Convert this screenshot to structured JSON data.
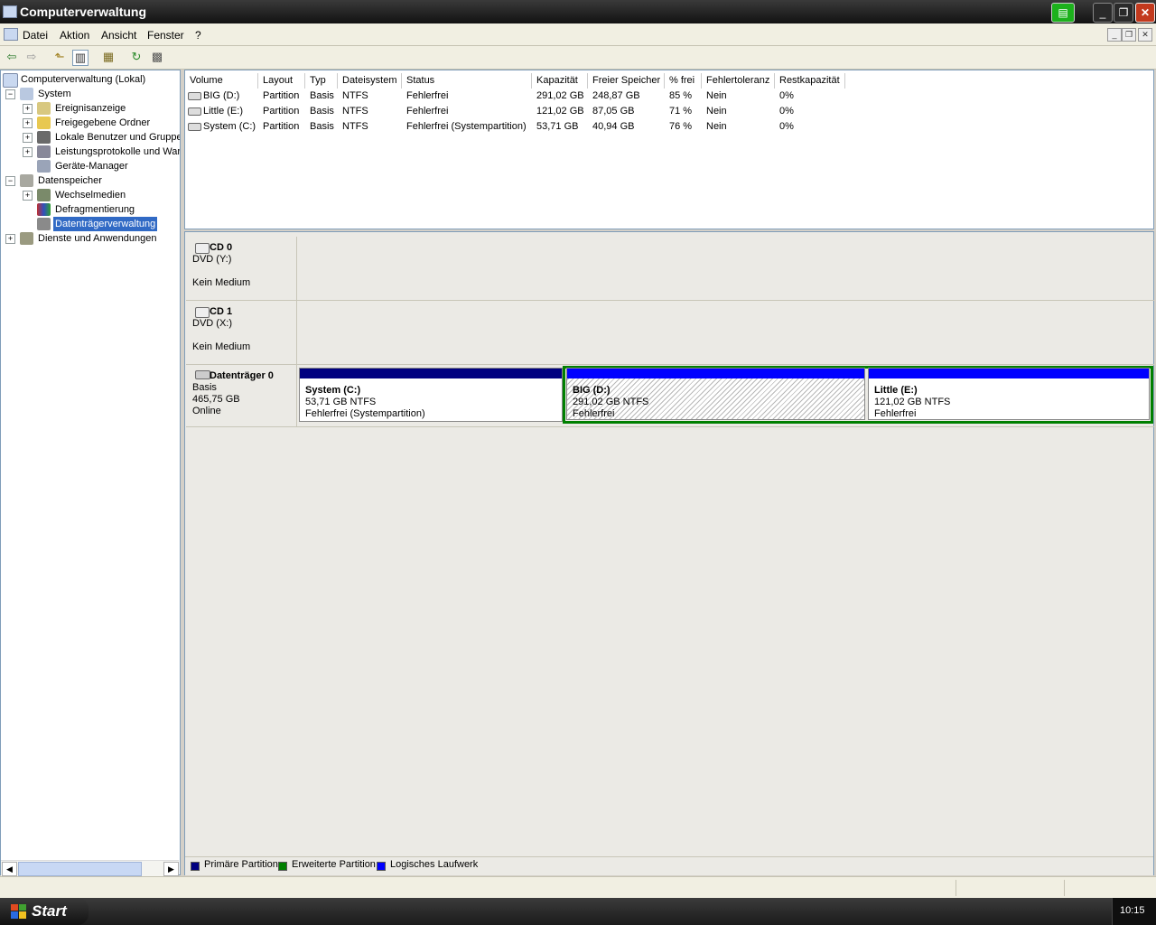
{
  "window": {
    "title": "Computerverwaltung"
  },
  "menu": [
    "Datei",
    "Aktion",
    "Ansicht",
    "Fenster",
    "?"
  ],
  "toolbar_icons": [
    "back-arrow-icon",
    "forward-arrow-icon",
    "up-folder-icon",
    "show-tree-icon",
    "properties-icon",
    "refresh-icon",
    "settings-icon"
  ],
  "tree": {
    "root": "Computerverwaltung (Lokal)",
    "system": "System",
    "ereignis": "Ereignisanzeige",
    "freigegeben": "Freigegebene Ordner",
    "benutzer": "Lokale Benutzer und Gruppen",
    "leistung": "Leistungsprotokolle und Warnungen",
    "geraete": "Geräte-Manager",
    "datenspeicher": "Datenspeicher",
    "wechsel": "Wechselmedien",
    "defrag": "Defragmentierung",
    "disk": "Datenträgerverwaltung",
    "dienste": "Dienste und Anwendungen"
  },
  "columns": [
    "Volume",
    "Layout",
    "Typ",
    "Dateisystem",
    "Status",
    "Kapazität",
    "Freier Speicher",
    "% frei",
    "Fehlertoleranz",
    "Restkapazität"
  ],
  "volumes": [
    [
      "BIG (D:)",
      "Partition",
      "Basis",
      "NTFS",
      "Fehlerfrei",
      "291,02 GB",
      "248,87 GB",
      "85 %",
      "Nein",
      "0%"
    ],
    [
      "Little (E:)",
      "Partition",
      "Basis",
      "NTFS",
      "Fehlerfrei",
      "121,02 GB",
      "87,05 GB",
      "71 %",
      "Nein",
      "0%"
    ],
    [
      "System (C:)",
      "Partition",
      "Basis",
      "NTFS",
      "Fehlerfrei (Systempartition)",
      "53,71 GB",
      "40,94 GB",
      "76 %",
      "Nein",
      "0%"
    ]
  ],
  "disks": {
    "cd0": {
      "title": "CD 0",
      "line1": "DVD (Y:)",
      "line2": "Kein Medium"
    },
    "cd1": {
      "title": "CD 1",
      "line1": "DVD (X:)",
      "line2": "Kein Medium"
    },
    "disk0": {
      "title": "Datenträger 0",
      "line1": "Basis",
      "line2": "465,75 GB",
      "line3": "Online",
      "partitions": [
        {
          "name": "System  (C:)",
          "size": "53,71 GB NTFS",
          "status": "Fehlerfrei (Systempartition)"
        },
        {
          "name": "BIG  (D:)",
          "size": "291,02 GB NTFS",
          "status": "Fehlerfrei"
        },
        {
          "name": "Little  (E:)",
          "size": "121,02 GB NTFS",
          "status": "Fehlerfrei"
        }
      ]
    }
  },
  "legend": [
    "Primäre Partition",
    "Erweiterte Partition",
    "Logisches Laufwerk"
  ],
  "colors": {
    "primary": "#000080",
    "extended": "#008000",
    "logical": "#0000ff",
    "selection": "#316ac5"
  },
  "taskbar": {
    "start": "Start",
    "clock": "10:15"
  }
}
